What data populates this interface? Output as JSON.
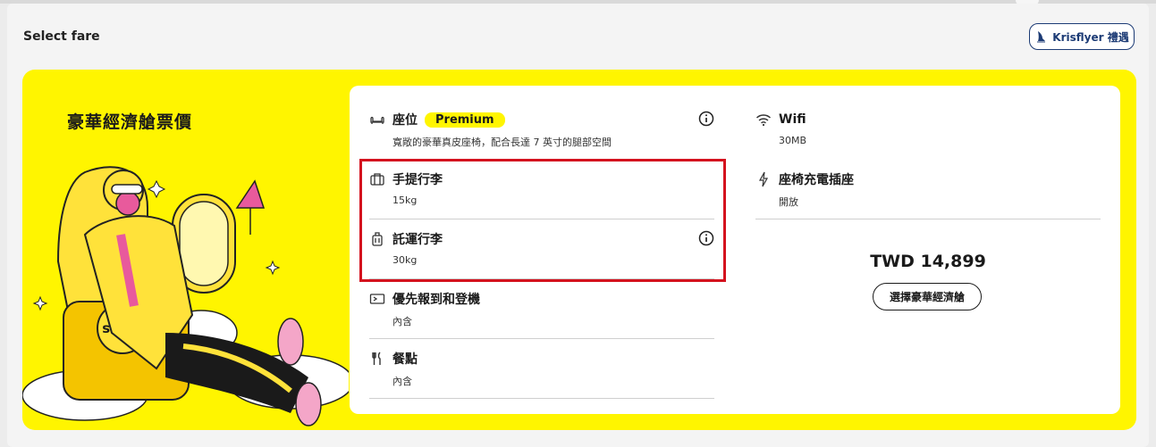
{
  "header": {
    "title": "Select fare",
    "krisflyer_label": "Krisflyer 禮遇"
  },
  "fare": {
    "name": "豪華經濟艙票價",
    "brand_logo_text": "scoot",
    "features_left": [
      {
        "icon": "seat-icon",
        "label": "座位",
        "badge": "Premium",
        "value": "寬敞的豪華真皮座椅，配合長達 7 英寸的腿部空間",
        "has_info": true
      },
      {
        "icon": "carry-on-bag-icon",
        "label": "手提行李",
        "value": "15kg",
        "has_info": false
      },
      {
        "icon": "checked-bag-icon",
        "label": "託運行李",
        "value": "30kg",
        "has_info": true
      },
      {
        "icon": "priority-boarding-icon",
        "label": "優先報到和登機",
        "value": "內含",
        "has_info": false
      },
      {
        "icon": "meal-icon",
        "label": "餐點",
        "value": "內含",
        "has_info": false
      }
    ],
    "features_right": [
      {
        "icon": "wifi-icon",
        "label": "Wifi",
        "value": "30MB"
      },
      {
        "icon": "power-icon",
        "label": "座椅充電插座",
        "value": "開放"
      }
    ],
    "price": "TWD 14,899",
    "select_label": "選擇豪華經濟艙"
  },
  "colors": {
    "brand_yellow": "#fff500",
    "highlight_red": "#d4121e",
    "krisflyer_blue": "#1c3b75"
  }
}
